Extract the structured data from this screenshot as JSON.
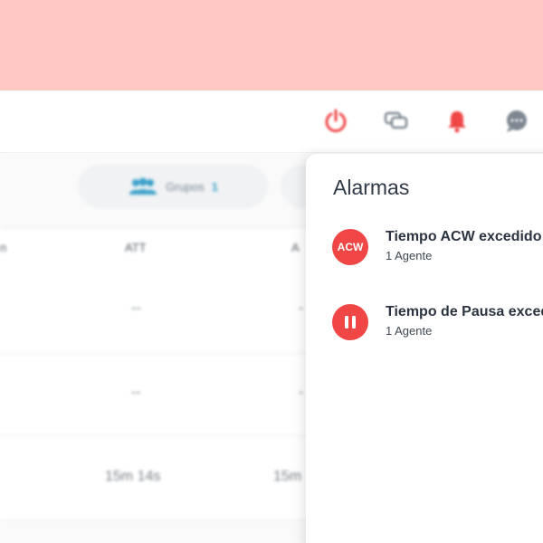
{
  "header": {
    "icons": [
      {
        "name": "power-icon",
        "color": "#f04646"
      },
      {
        "name": "chat-bubbles-icon",
        "color": "#7c8791"
      },
      {
        "name": "bell-icon",
        "color": "#f04646"
      },
      {
        "name": "message-icon",
        "color": "#7c8791"
      }
    ]
  },
  "background": {
    "groups_label": "Grupos",
    "groups_count": "1",
    "columns": {
      "first": "n",
      "att": "ATT",
      "third": "A"
    },
    "rows": [
      {
        "att": "--",
        "third": "-"
      },
      {
        "att": "--",
        "third": "-"
      },
      {
        "att": "15m 14s",
        "third": "15m"
      }
    ]
  },
  "alarms_panel": {
    "title": "Alarmas",
    "items": [
      {
        "badge_text": "ACW",
        "title": "Tiempo ACW excedido",
        "subtitle": "1 Agente",
        "icon": "acw-icon"
      },
      {
        "badge_text": "",
        "title": "Tiempo de Pausa excedido",
        "subtitle": "1 Agente",
        "icon": "pause-icon"
      }
    ],
    "accent_color": "#f04646"
  }
}
